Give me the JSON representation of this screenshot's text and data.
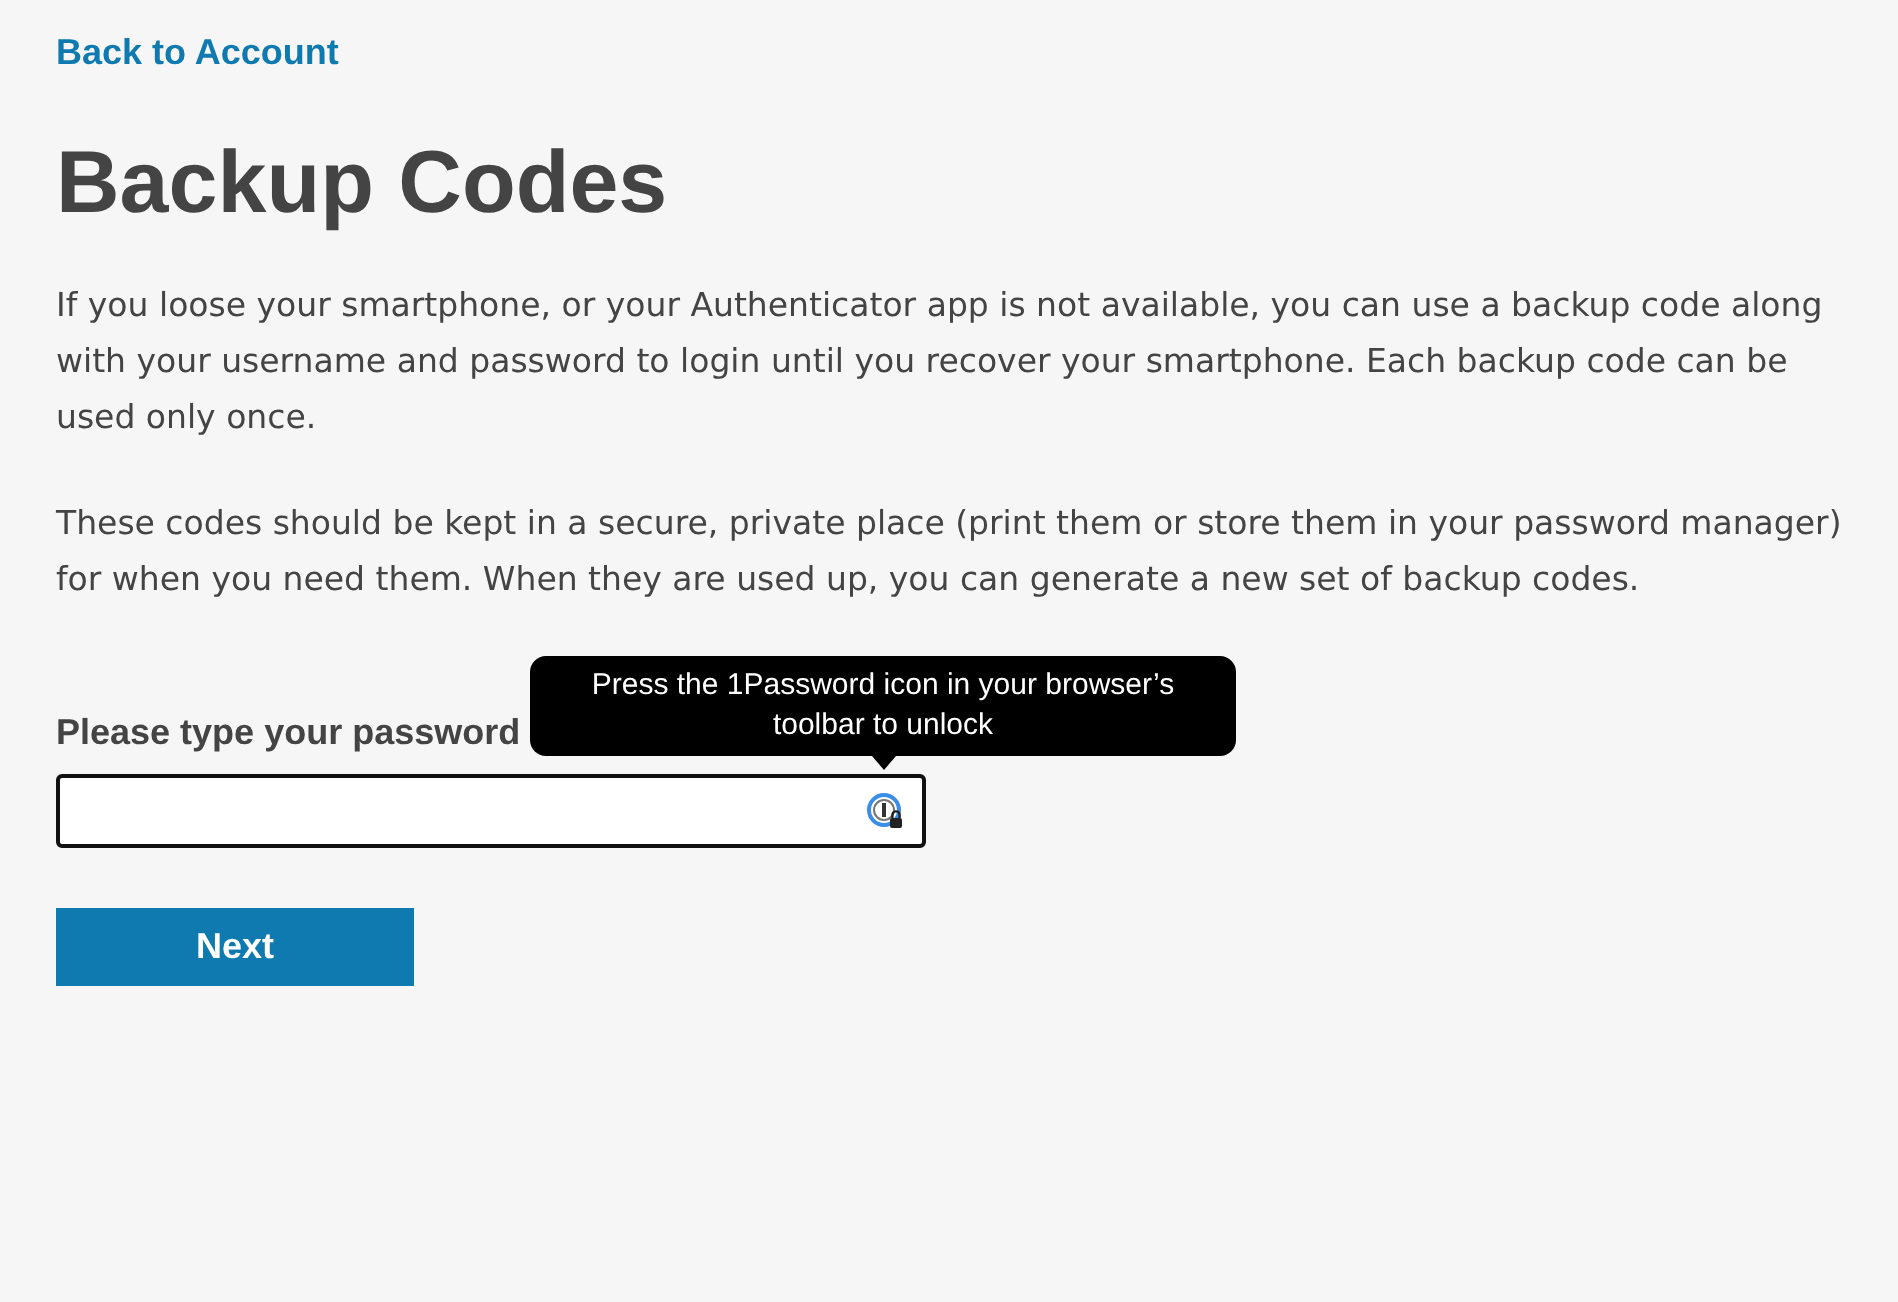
{
  "back_link": "Back to Account",
  "title": "Backup Codes",
  "paragraphs": [
    "If you loose your smartphone, or your Authenticator app is not available, you can use a backup code along with your username and password to login until you recover your smartphone. Each backup code can be used only once.",
    "These codes should be kept in a secure, private place (print them or store them in your password manager) for when you need them. When they are used up, you can generate a new set of backup codes."
  ],
  "password_field": {
    "label": "Please type your password"
  },
  "tooltip": "Press the 1Password icon in your browser’s toolbar to unlock",
  "button": "Next"
}
